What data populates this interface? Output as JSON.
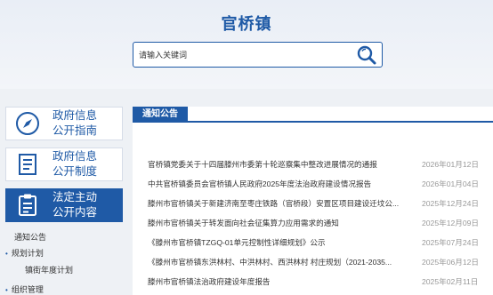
{
  "header": {
    "site_title": "官桥镇"
  },
  "search": {
    "placeholder": "请输入关键词",
    "icon": "search-icon"
  },
  "left_nav": [
    {
      "line1": "政府信息",
      "line2": "公开指南",
      "icon": "compass-icon",
      "active": false
    },
    {
      "line1": "政府信息",
      "line2": "公开制度",
      "icon": "document-icon",
      "active": false
    },
    {
      "line1": "法定主动",
      "line2": "公开内容",
      "icon": "clipboard-icon",
      "active": true
    }
  ],
  "sub_menu": [
    {
      "label": "通知公告"
    },
    {
      "label": "规划计划"
    },
    {
      "label": "镇街年度计划"
    },
    {
      "label": "组织管理"
    }
  ],
  "notice": {
    "tab_label": "通知公告",
    "items": [
      {
        "title": "官桥镇党委关于十四届滕州市委第十轮巡察集中整改进展情况的通报",
        "date": "2026年01月12日"
      },
      {
        "title": "中共官桥镇委员会官桥镇人民政府2025年度法治政府建设情况报告",
        "date": "2026年01月04日"
      },
      {
        "title": "滕州市官桥镇关于新建济南至枣庄铁路（官桥段）安置区项目建设迁坟公...",
        "date": "2025年12月24日"
      },
      {
        "title": "滕州市官桥镇关于转发面向社会征集算力应用需求的通知",
        "date": "2025年12月09日"
      },
      {
        "title": "《滕州市官桥镇TZGQ-01单元控制性详细规划》公示",
        "date": "2025年07月24日"
      },
      {
        "title": "《滕州市官桥镇东洪林村、中洪林村、西洪林村  村庄规划（2021-2035...",
        "date": "2025年06月12日"
      },
      {
        "title": "滕州市官桥镇法治政府建设年度报告",
        "date": "2025年02月11日"
      }
    ]
  },
  "colors": {
    "accent": "#1f5aa6",
    "date": "#999999"
  }
}
